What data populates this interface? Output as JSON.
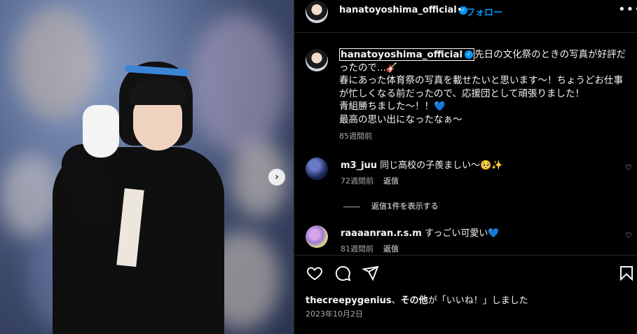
{
  "post": {
    "username": "hanatoyoshima_official",
    "follow_label": "フォロー",
    "dot": "•",
    "more_label": "•••"
  },
  "caption": {
    "username": "hanatoyoshima_official",
    "text_line1": "先日の文化祭のときの写真が好評だったので...🎸",
    "text_line2": "春にあった体育祭の写真を載せたいと思います〜！ちょうどお仕事が忙しくなる前だったので、応援団として頑張りました！",
    "text_line3": "青組勝ちました〜！！💙",
    "text_line4": "最高の思い出になったなぁ〜",
    "time": "85週間前"
  },
  "comments": [
    {
      "username": "m3_juu",
      "text": "同じ高校の子羨ましい〜🥺✨",
      "time": "72週間前",
      "reply_label": "返信"
    },
    {
      "username": "raaaanran.r.s.m",
      "text": "すっごい可愛い💙",
      "time": "81週間前",
      "reply_label": "返信"
    }
  ],
  "view_replies_label": "返信1件を表示する",
  "likes": {
    "user": "thecreepygenius",
    "separator": "、",
    "others": "その他",
    "suffix": "が「いいね！」しました"
  },
  "date": "2023年10月2日",
  "icons": {
    "like": "heart-icon",
    "comment": "comment-icon",
    "share": "share-icon",
    "save": "bookmark-icon",
    "verified": "verified-badge-icon",
    "next": "chevron-right-icon"
  },
  "colors": {
    "accent": "#0095f6",
    "background": "#000000",
    "secondary_text": "#a8a8a8"
  }
}
